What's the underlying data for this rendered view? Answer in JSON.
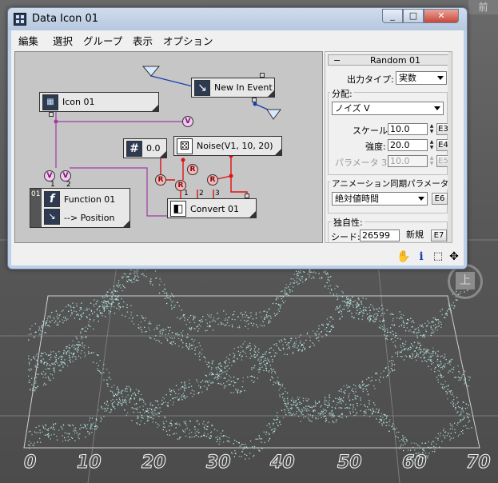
{
  "window": {
    "title": "Data Icon 01",
    "buttons": {
      "minimize": "_",
      "maximize": "□",
      "close": "✕"
    }
  },
  "menu": [
    "編集",
    "選択",
    "グループ",
    "表示",
    "オプション"
  ],
  "nodes": {
    "icon01": {
      "label": "Icon 01",
      "icon": "data-icon"
    },
    "new_in_event": {
      "label": "New In Event",
      "icon": "event-icon"
    },
    "constant": {
      "label": "0.0",
      "icon": "hash-icon"
    },
    "noise": {
      "label": "Noise(V1, 10, 20)",
      "icon": "dice-icon"
    },
    "function01": {
      "label": "Function 01",
      "output": "--> Position",
      "badge": "01",
      "icon": "function-icon"
    },
    "convert01": {
      "label": "Convert 01",
      "icon": "convert-icon"
    }
  },
  "ports": {
    "v": "V",
    "r": "R",
    "fn_port_1": "1",
    "fn_port_2": "2",
    "conv_port_1": "1",
    "conv_port_2": "2",
    "conv_port_3": "3"
  },
  "panel": {
    "rollout_title": "Random 01",
    "rollout_toggle": "−",
    "output_type_label": "出力タイプ:",
    "output_type_value": "実数",
    "distribution_label": "分配:",
    "distribution_value": "ノイズ V",
    "scale_label": "スケール:",
    "scale_value": "10.0",
    "scale_btn": "E3",
    "strength_label": "強度:",
    "strength_value": "20.0",
    "strength_btn": "E4",
    "param3_label": "パラメータ 3:",
    "param3_value": "10.0",
    "param3_btn": "E5",
    "anim_sync_label": "アニメーション同期パラメータ:",
    "anim_sync_value": "絶対値時間",
    "anim_sync_btn": "E6",
    "uniqueness_label": "独自性:",
    "seed_label": "シード:",
    "seed_value": "26599",
    "new_btn": "新規",
    "seed_btn": "E7"
  },
  "status_icons": [
    "hand-icon",
    "info-icon",
    "select-region-icon",
    "navigate-icon"
  ],
  "viewport": {
    "axis_ticks": [
      "0",
      "10",
      "20",
      "30",
      "40",
      "50",
      "60",
      "70"
    ],
    "viewcube_face": "上",
    "corner_label": "前"
  },
  "colors": {
    "particles": "#bff5ee",
    "wire_event": "#1a3fb3",
    "wire_value": "#e01010",
    "wire_vector": "#a23aa6",
    "canvas": "#c6c6c6"
  }
}
